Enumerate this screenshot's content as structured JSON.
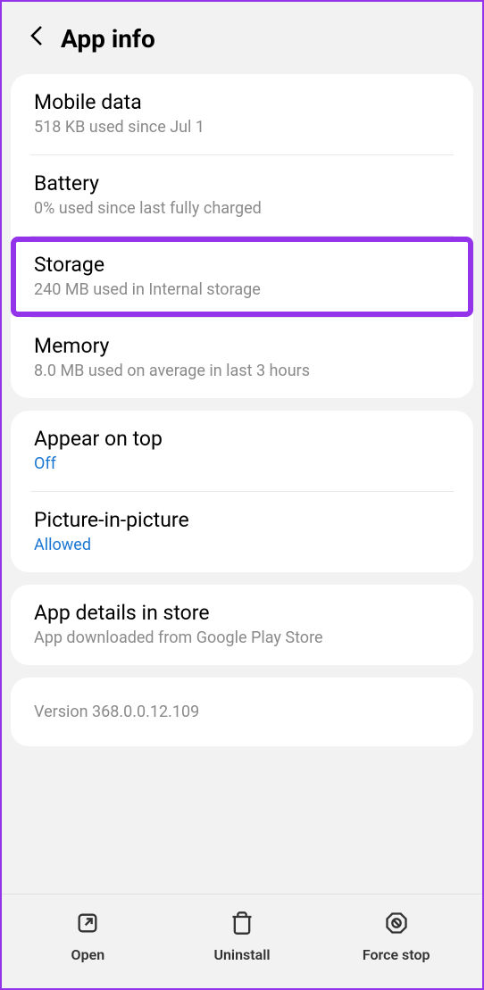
{
  "header": {
    "title": "App info"
  },
  "section1": {
    "mobile_data": {
      "title": "Mobile data",
      "subtitle": "518 KB used since Jul 1"
    },
    "battery": {
      "title": "Battery",
      "subtitle": "0% used since last fully charged"
    },
    "storage": {
      "title": "Storage",
      "subtitle": "240 MB used in Internal storage"
    },
    "memory": {
      "title": "Memory",
      "subtitle": "8.0 MB used on average in last 3 hours"
    }
  },
  "section2": {
    "appear_on_top": {
      "title": "Appear on top",
      "value": "Off"
    },
    "pip": {
      "title": "Picture-in-picture",
      "value": "Allowed"
    }
  },
  "section3": {
    "app_details": {
      "title": "App details in store",
      "subtitle": "App downloaded from Google Play Store"
    }
  },
  "version": "Version 368.0.0.12.109",
  "bottom": {
    "open": "Open",
    "uninstall": "Uninstall",
    "force_stop": "Force stop"
  }
}
